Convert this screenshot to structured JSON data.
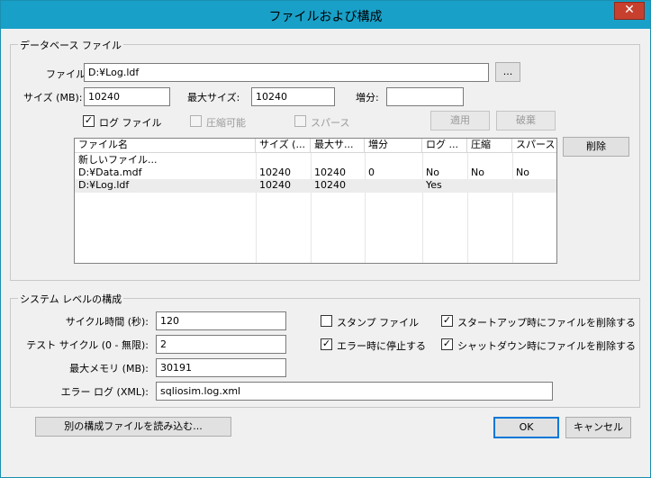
{
  "window": {
    "title": "ファイルおよび構成",
    "close_label": "✕"
  },
  "database_files": {
    "group_label": "データベース ファイル",
    "file_label": "ファイル:",
    "file_value": "D:¥Log.ldf",
    "browse_label": "...",
    "size_label": "サイズ (MB):",
    "size_value": "10240",
    "max_size_label": "最大サイズ:",
    "max_size_value": "10240",
    "growth_label": "増分:",
    "growth_value": "",
    "log_file": {
      "label": "ログ ファイル",
      "checked": true
    },
    "compressible": {
      "label": "圧縮可能",
      "checked": false
    },
    "sparse": {
      "label": "スパース",
      "checked": false
    },
    "apply_label": "適用",
    "discard_label": "破棄",
    "delete_label": "削除",
    "columns": [
      "ファイル名",
      "サイズ (...",
      "最大サ...",
      "増分",
      "ログ ...",
      "圧縮",
      "スパース"
    ],
    "rows": [
      [
        "新しいファイル...",
        "",
        "",
        "",
        "",
        "",
        ""
      ],
      [
        "D:¥Data.mdf",
        "10240",
        "10240",
        "0",
        "No",
        "No",
        "No"
      ],
      [
        "D:¥Log.ldf",
        "10240",
        "10240",
        "",
        "Yes",
        "",
        ""
      ]
    ]
  },
  "system_config": {
    "group_label": "システム レベルの構成",
    "cycle_time_label": "サイクル時間 (秒):",
    "cycle_time_value": "120",
    "test_cycles_label": "テスト サイクル (0 - 無限):",
    "test_cycles_value": "2",
    "max_memory_label": "最大メモリ (MB):",
    "max_memory_value": "30191",
    "error_log_label": "エラー ログ (XML):",
    "error_log_value": "sqliosim.log.xml",
    "stamp_file": {
      "label": "スタンプ ファイル",
      "checked": false
    },
    "stop_on_error": {
      "label": "エラー時に停止する",
      "checked": true
    },
    "delete_on_startup": {
      "label": "スタートアップ時にファイルを削除する",
      "checked": true
    },
    "delete_on_shutdown": {
      "label": "シャットダウン時にファイルを削除する",
      "checked": true
    }
  },
  "footer": {
    "load_config_label": "別の構成ファイルを読み込む...",
    "ok_label": "OK",
    "cancel_label": "キャンセル"
  }
}
